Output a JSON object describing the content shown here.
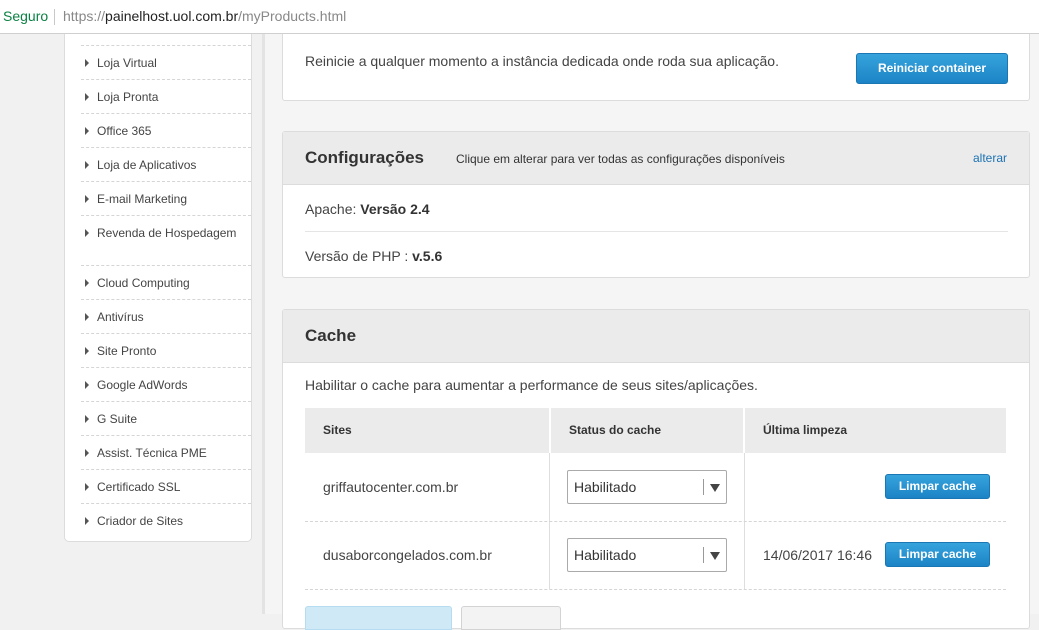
{
  "browser": {
    "security_label": "Seguro",
    "url_scheme": "https://",
    "url_host": "painelhost.uol.com.br",
    "url_path": "/myProducts.html"
  },
  "sidebar": {
    "items": [
      {
        "label": "Loja Virtual"
      },
      {
        "label": "Loja Pronta"
      },
      {
        "label": "Office 365"
      },
      {
        "label": "Loja de Aplicativos"
      },
      {
        "label": "E-mail Marketing"
      },
      {
        "label": "Revenda de Hospedagem"
      },
      {
        "label": "Cloud Computing"
      },
      {
        "label": "Antivírus"
      },
      {
        "label": "Site Pronto"
      },
      {
        "label": "Google AdWords"
      },
      {
        "label": "G Suite"
      },
      {
        "label": "Assist. Técnica PME"
      },
      {
        "label": "Certificado SSL"
      },
      {
        "label": "Criador de Sites"
      }
    ]
  },
  "restart": {
    "description": "Reinicie a qualquer momento a instância dedicada onde roda sua aplicação.",
    "button_label": "Reiniciar container"
  },
  "config": {
    "title": "Configurações",
    "subtitle": "Clique em alterar para ver todas as configurações disponíveis",
    "edit_link": "alterar",
    "apache_label": "Apache:",
    "apache_value": "Versão 2.4",
    "php_label": "Versão de PHP :",
    "php_value": "v.5.6"
  },
  "cache": {
    "title": "Cache",
    "description": "Habilitar o cache para aumentar a performance de seus sites/aplicações.",
    "columns": [
      "Sites",
      "Status do cache",
      "Última limpeza"
    ],
    "rows": [
      {
        "site": "griffautocenter.com.br",
        "status": "Habilitado",
        "last_clear": "",
        "button": "Limpar cache"
      },
      {
        "site": "dusaborcongelados.com.br",
        "status": "Habilitado",
        "last_clear": "14/06/2017 16:46",
        "button": "Limpar cache"
      }
    ]
  }
}
